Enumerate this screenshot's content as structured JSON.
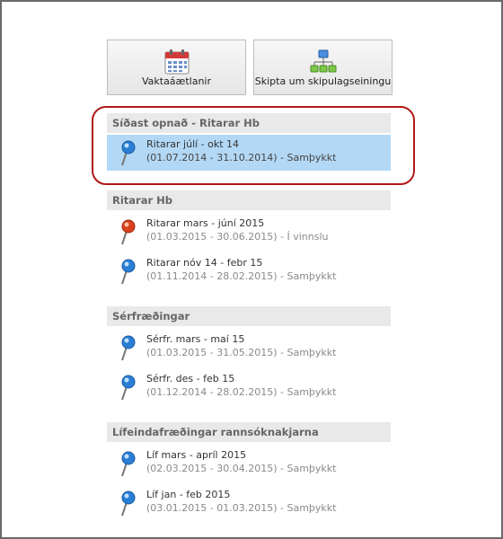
{
  "toolbar": {
    "schedule_label": "Vaktaáætlanir",
    "switch_unit_label": "Skipta um skipulagseiningu"
  },
  "recent": {
    "header": "Síðast opnað - Ritarar Hb",
    "items": [
      {
        "title": "Ritarar júlí - okt 14",
        "detail": "(01.07.2014 - 31.10.2014) - Samþykkt",
        "status": "approved"
      }
    ]
  },
  "groups": [
    {
      "header": "Ritarar Hb",
      "items": [
        {
          "title": "Ritarar mars - júní 2015",
          "detail": "(01.03.2015 - 30.06.2015) - Í vinnslu",
          "status": "in-progress"
        },
        {
          "title": "Ritarar nóv 14 - febr 15",
          "detail": "(01.11.2014 - 28.02.2015) - Samþykkt",
          "status": "approved"
        }
      ]
    },
    {
      "header": "Sérfræðingar",
      "items": [
        {
          "title": "Sérfr. mars - maí 15",
          "detail": "(01.03.2015 - 31.05.2015) - Samþykkt",
          "status": "approved"
        },
        {
          "title": "Sérfr. des - feb 15",
          "detail": "(01.12.2014 - 28.02.2015) - Samþykkt",
          "status": "approved"
        }
      ]
    },
    {
      "header": "Lífeindafræðingar rannsóknakjarna",
      "items": [
        {
          "title": "Líf mars - apríl 2015",
          "detail": "(02.03.2015 - 30.04.2015) - Samþykkt",
          "status": "approved"
        },
        {
          "title": "Líf jan - feb 2015",
          "detail": "(03.01.2015 - 01.03.2015) - Samþykkt",
          "status": "approved"
        }
      ]
    }
  ],
  "colors": {
    "selected_bg": "#b3d8f5",
    "pin_blue": "#2a7fd4",
    "pin_red": "#d9411e",
    "highlight_ring": "#b01818"
  },
  "icons": {
    "schedule": "calendar-icon",
    "switch_unit": "org-chart-icon",
    "approved": "blue-pin-icon",
    "in_progress": "red-pin-icon"
  }
}
